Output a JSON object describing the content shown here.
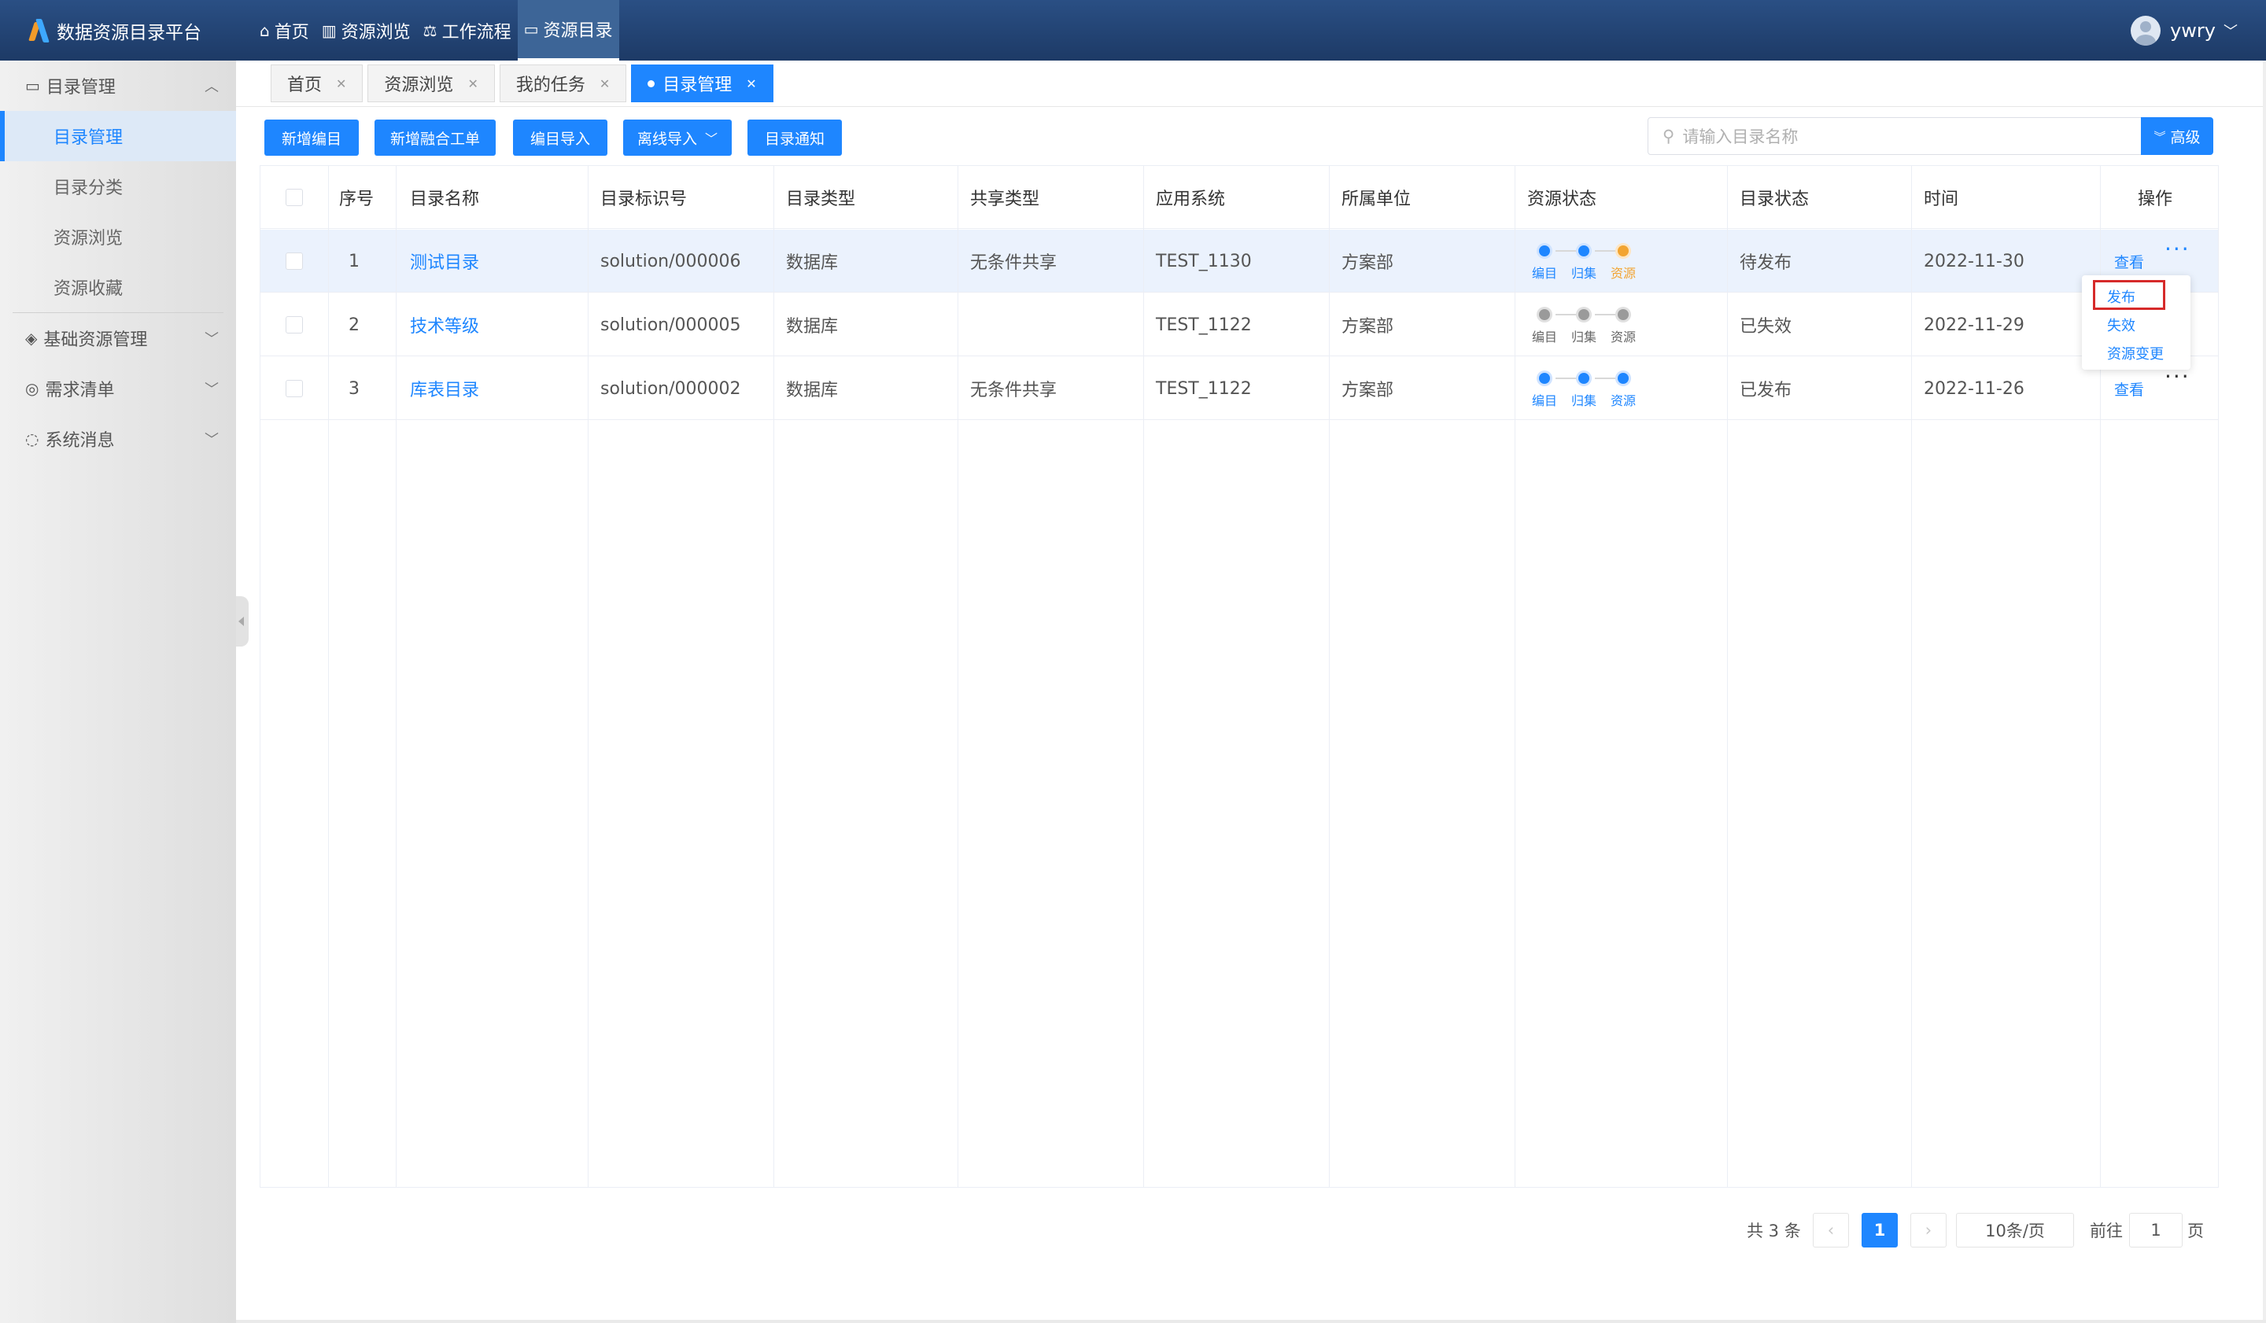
{
  "app": {
    "title": "数据资源目录平台"
  },
  "topnav": [
    {
      "label": "首页",
      "icon": "home-icon",
      "glyph": "⌂"
    },
    {
      "label": "资源浏览",
      "icon": "book-icon",
      "glyph": "▥"
    },
    {
      "label": "工作流程",
      "icon": "workflow-icon",
      "glyph": "⚖"
    },
    {
      "label": "资源目录",
      "icon": "folder-icon",
      "glyph": "▭",
      "active": true
    }
  ],
  "user": {
    "name": "ywry"
  },
  "sidebar": {
    "group1": "目录管理",
    "subs": [
      "目录管理",
      "目录分类",
      "资源浏览",
      "资源收藏"
    ],
    "group2": "基础资源管理",
    "group3": "需求清单",
    "group4": "系统消息"
  },
  "tabs": [
    {
      "label": "首页"
    },
    {
      "label": "资源浏览"
    },
    {
      "label": "我的任务"
    },
    {
      "label": "目录管理",
      "active": true
    }
  ],
  "toolbar": {
    "new_catalog": "新增编目",
    "new_fusion": "新增融合工单",
    "import_catalog": "编目导入",
    "offline_import": "离线导入",
    "notify": "目录通知",
    "search_placeholder": "请输入目录名称",
    "advanced": "高级"
  },
  "table": {
    "headers": [
      "序号",
      "目录名称",
      "目录标识号",
      "目录类型",
      "共享类型",
      "应用系统",
      "所属单位",
      "资源状态",
      "目录状态",
      "时间",
      "操作"
    ],
    "step_labels": [
      "编目",
      "归集",
      "资源"
    ],
    "rows": [
      {
        "index": "1",
        "name": "测试目录",
        "id": "solution/000006",
        "type": "数据库",
        "share": "无条件共享",
        "system": "TEST_1130",
        "unit": "方案部",
        "status": "待发布",
        "time": "2022-11-30",
        "action": "查看"
      },
      {
        "index": "2",
        "name": "技术等级",
        "id": "solution/000005",
        "type": "数据库",
        "share": "",
        "system": "TEST_1122",
        "unit": "方案部",
        "status": "已失效",
        "time": "2022-11-29",
        "action": ""
      },
      {
        "index": "3",
        "name": "库表目录",
        "id": "solution/000002",
        "type": "数据库",
        "share": "无条件共享",
        "system": "TEST_1122",
        "unit": "方案部",
        "status": "已发布",
        "time": "2022-11-26",
        "action": "查看"
      }
    ]
  },
  "dropdown": [
    "发布",
    "失效",
    "资源变更"
  ],
  "pagination": {
    "total": "共 3 条",
    "current": "1",
    "page_size": "10条/页",
    "goto_label": "前往",
    "goto_value": "1",
    "page_suffix": "页"
  },
  "colors": {
    "accent": "#1e86ff",
    "header": "#1d3a66",
    "pending": "#f2a431",
    "highlight": "#d62a2a"
  }
}
